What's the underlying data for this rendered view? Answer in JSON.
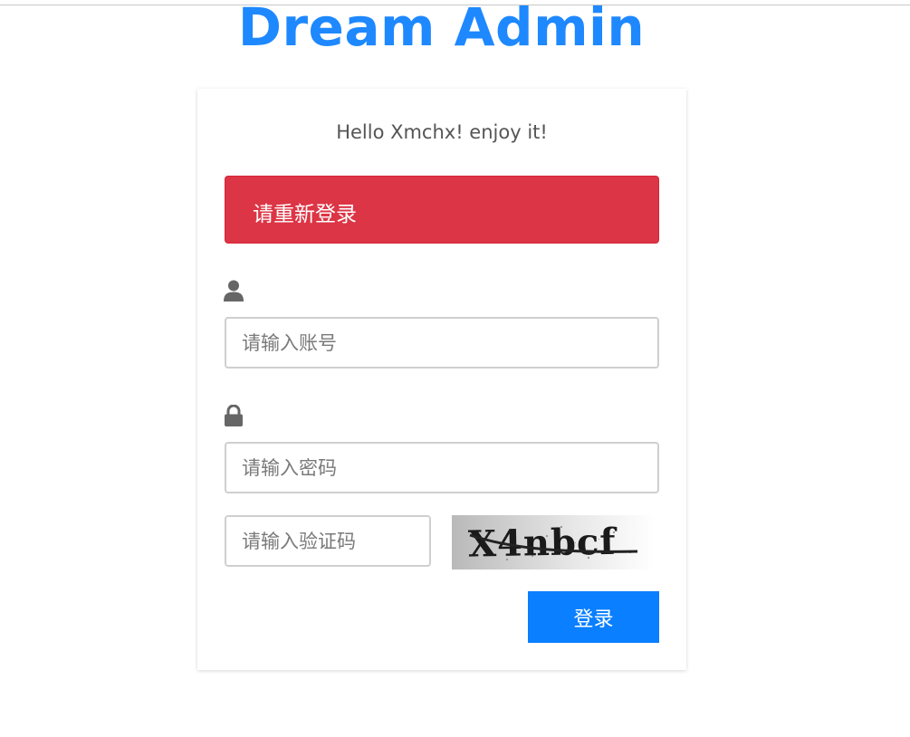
{
  "app": {
    "title": "Dream Admin",
    "accent_color": "#1e88ff"
  },
  "card": {
    "welcome_text": "Hello Xmchx! enjoy it!"
  },
  "alert": {
    "message": "请重新登录",
    "color": "#dc3545"
  },
  "username": {
    "icon": "user-icon",
    "placeholder": "请输入账号",
    "value": ""
  },
  "password": {
    "icon": "lock-icon",
    "placeholder": "请输入密码",
    "value": ""
  },
  "captcha": {
    "placeholder": "请输入验证码",
    "value": "",
    "image_text": "X4nbcf"
  },
  "login_button": {
    "label": "登录",
    "color": "#0a7fff"
  }
}
